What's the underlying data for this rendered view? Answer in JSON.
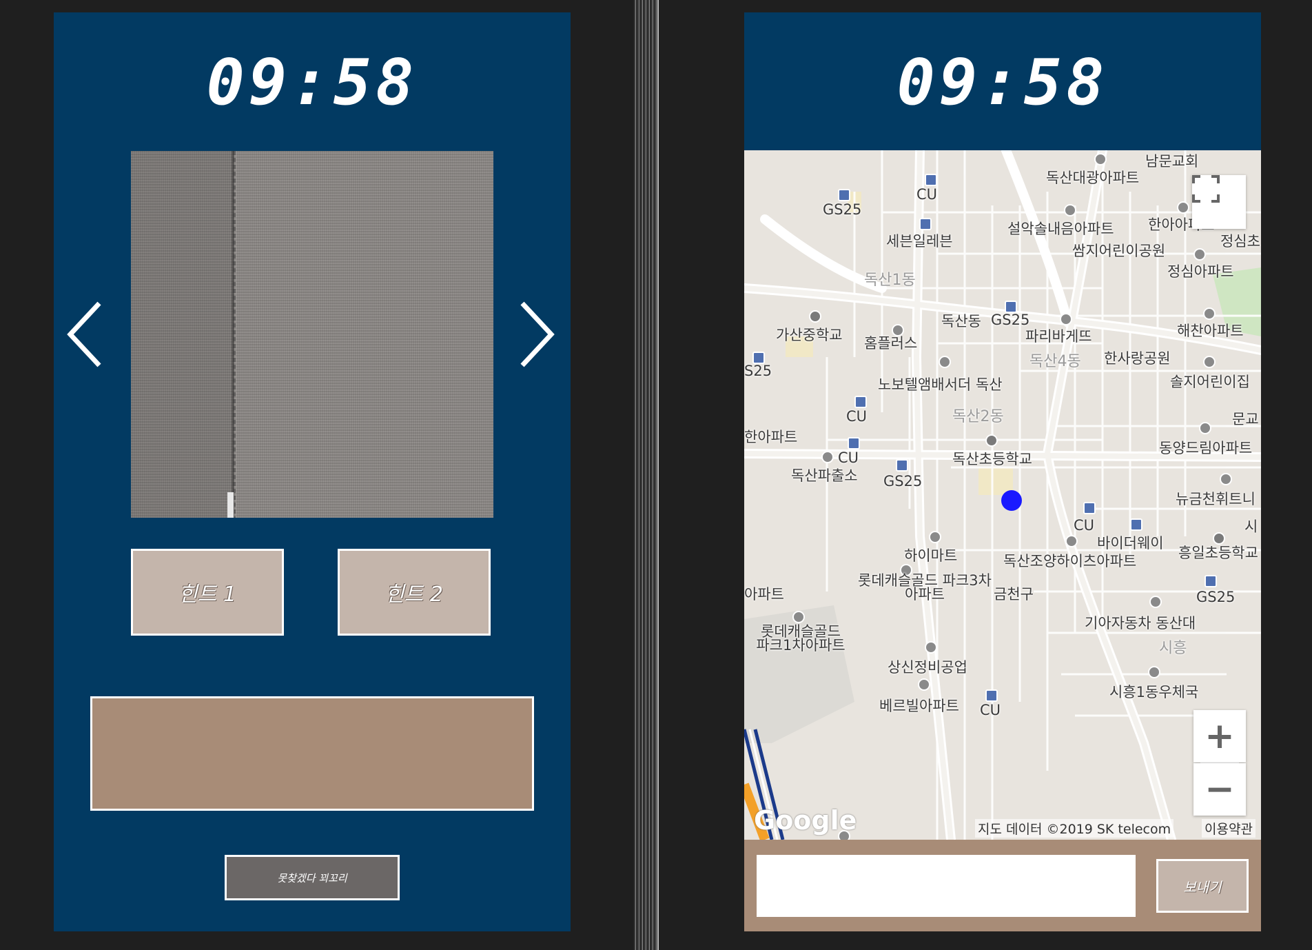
{
  "left_screen": {
    "clock": "09:58",
    "hint1_label": "힌트 1",
    "hint2_label": "힌트 2",
    "giveup_label": "못찾겠다 꾀꼬리"
  },
  "right_screen": {
    "clock": "09:58",
    "send_label": "보내기",
    "message_input_value": "",
    "map": {
      "labels": {
        "namun_church": "남문교회",
        "doksan_daegwang": "독산대광아파트",
        "cu_1": "CU",
        "gs25_1": "GS25",
        "seolak": "설악솔내음아파트",
        "hanaa": "한아아파트",
        "jeongsimcho": "정심초",
        "seven_eleven": "세븐일레븐",
        "ssamji": "쌈지어린이공원",
        "doksan1dong": "독산1동",
        "jeongsim_apt": "정심아파트",
        "gasan_middle": "가산중학교",
        "homeplus": "홈플러스",
        "doksandong": "독산동",
        "gs25_2": "GS25",
        "paris": "파리바게뜨",
        "haechan": "해찬아파트",
        "gs25_3": "S25",
        "doksan4dong": "독산4동",
        "hansarang": "한사랑공원",
        "solji": "솔지어린이집",
        "novotel": "노보텔앰배서더 독산",
        "doksan2dong": "독산2동",
        "cu_2": "CU",
        "mun": "문교",
        "apt_left": "한아파트",
        "dongyang": "동양드림아파트",
        "cu_3": "CU",
        "doksan_police": "독산파출소",
        "doksan_elem": "독산초등학교",
        "gs25_4": "GS25",
        "newgeumcheon": "뉴금천휘트니",
        "cu_4": "CU",
        "bydeway": "바이더웨이",
        "si": "시",
        "himart": "하이마트",
        "doksan_joyang": "독산조양하이츠아파트",
        "heungil": "흥일초등학교",
        "apt_left2": "아파트",
        "lotte_castle3": "롯데캐슬골드 파크3차아파트",
        "geumcheongu": "금천구",
        "gs25_5": "GS25",
        "kia": "기아자동차 동산대",
        "siheung": "시흥",
        "lotte_castle1": "롯데캐슬골드 파크1차아파트",
        "sangsin": "상신정비공업",
        "siheung1post": "시흥1동우체국",
        "berville": "베르빌아파트",
        "cu_5": "CU"
      },
      "google_logo": "Google",
      "attribution": "지도 데이터 ©2019 SK telecom",
      "terms": "이용약관",
      "zoom_in": "+",
      "zoom_out": "−"
    }
  },
  "colors": {
    "phone_bg": "#023a62",
    "hint_button": "#c4b5ab",
    "answer_area": "#a88c77",
    "giveup_button": "#6b6766",
    "location_dot": "#1a1aff"
  },
  "icons": [
    "arrow-left-icon",
    "arrow-right-icon",
    "fullscreen-icon",
    "location-dot-icon"
  ]
}
